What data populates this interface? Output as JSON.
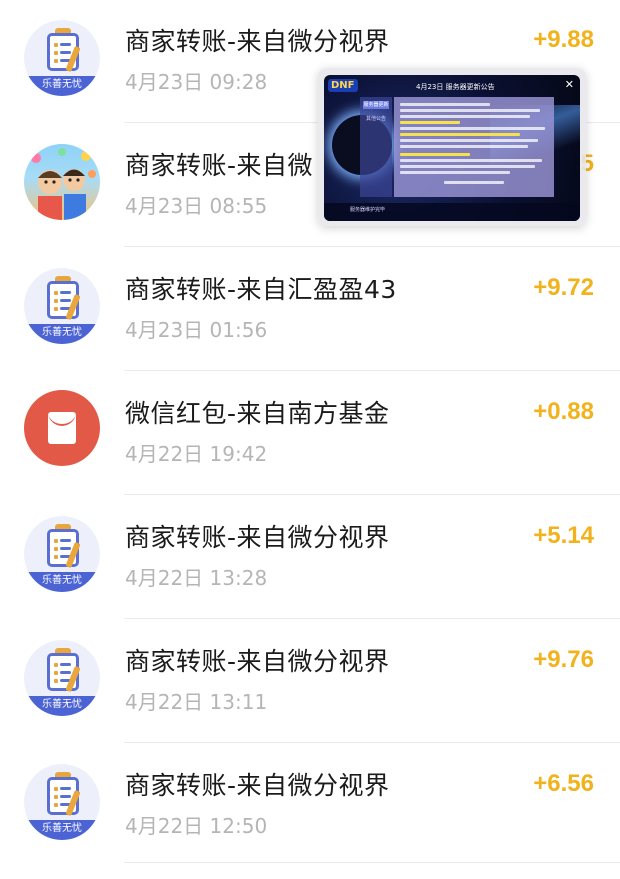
{
  "transactions": [
    {
      "title": "商家转账-来自微分视界",
      "time": "4月23日 09:28",
      "amount": "+9.88",
      "avatar": "merchant-clipboard",
      "avatar_text": "乐善无忧"
    },
    {
      "title": "商家转账-来自微",
      "time": "4月23日 08:55",
      "amount": "5",
      "avatar": "cartoon-kids"
    },
    {
      "title": "商家转账-来自汇盈盈43",
      "time": "4月23日 01:56",
      "amount": "+9.72",
      "avatar": "merchant-clipboard",
      "avatar_text": "乐善无忧"
    },
    {
      "title": "微信红包-来自南方基金",
      "time": "4月22日 19:42",
      "amount": "+0.88",
      "avatar": "red-packet"
    },
    {
      "title": "商家转账-来自微分视界",
      "time": "4月22日 13:28",
      "amount": "+5.14",
      "avatar": "merchant-clipboard",
      "avatar_text": "乐善无忧"
    },
    {
      "title": "商家转账-来自微分视界",
      "time": "4月22日 13:11",
      "amount": "+9.76",
      "avatar": "merchant-clipboard",
      "avatar_text": "乐善无忧"
    },
    {
      "title": "商家转账-来自微分视界",
      "time": "4月22日 12:50",
      "amount": "+6.56",
      "avatar": "merchant-clipboard",
      "avatar_text": "乐善无忧"
    }
  ],
  "overlay": {
    "logo": "DNF",
    "title": "4月23日 服务器更新公告",
    "close_glyph": "✕",
    "tab_active": "服务器更新",
    "tab_other": "其他公告",
    "footer": "服务器维护完毕"
  },
  "colors": {
    "amount": "#f2b21c",
    "merchant_ribbon": "#4b63d3",
    "red_packet": "#e25a47"
  }
}
